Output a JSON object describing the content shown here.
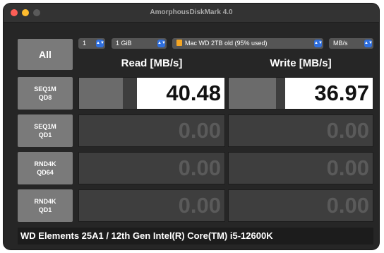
{
  "window": {
    "title": "AmorphousDiskMark 4.0",
    "colors": {
      "close": "#fe5f57",
      "minimize": "#febc2e"
    }
  },
  "controls": {
    "all_label": "All",
    "count": "1",
    "size": "1 GiB",
    "drive": "Mac WD 2TB old (95% used)",
    "unit": "MB/s"
  },
  "headers": {
    "read": "Read [MB/s]",
    "write": "Write [MB/s]"
  },
  "tests": [
    {
      "line1": "SEQ1M",
      "line2": "QD8",
      "read": "40.48",
      "write": "36.97",
      "read_bar": 0.3,
      "write_bar": 0.33
    },
    {
      "line1": "SEQ1M",
      "line2": "QD1",
      "read": "0.00",
      "write": "0.00"
    },
    {
      "line1": "RND4K",
      "line2": "QD64",
      "read": "0.00",
      "write": "0.00"
    },
    {
      "line1": "RND4K",
      "line2": "QD1",
      "read": "0.00",
      "write": "0.00"
    }
  ],
  "footer": "WD Elements 25A1 / 12th Gen Intel(R) Core(TM) i5-12600K"
}
